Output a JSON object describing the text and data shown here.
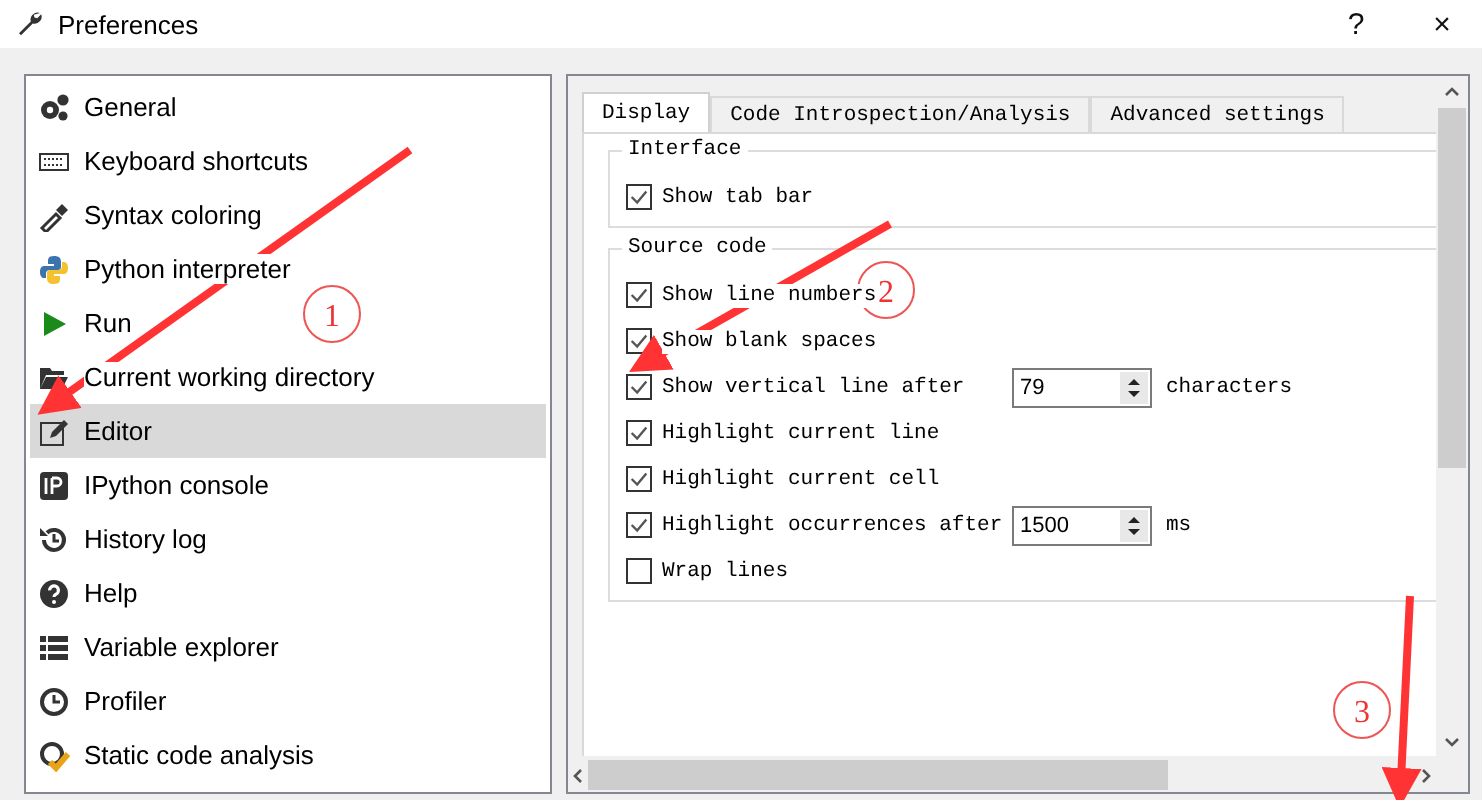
{
  "window": {
    "title": "Preferences",
    "help": "?",
    "close": "×"
  },
  "sidebar": {
    "items": [
      {
        "label": "General",
        "selected": false
      },
      {
        "label": "Keyboard shortcuts",
        "selected": false
      },
      {
        "label": "Syntax coloring",
        "selected": false
      },
      {
        "label": "Python interpreter",
        "selected": false
      },
      {
        "label": "Run",
        "selected": false
      },
      {
        "label": "Current working directory",
        "selected": false
      },
      {
        "label": "Editor",
        "selected": true
      },
      {
        "label": "IPython console",
        "selected": false
      },
      {
        "label": "History log",
        "selected": false
      },
      {
        "label": "Help",
        "selected": false
      },
      {
        "label": "Variable explorer",
        "selected": false
      },
      {
        "label": "Profiler",
        "selected": false
      },
      {
        "label": "Static code analysis",
        "selected": false
      }
    ]
  },
  "tabs": [
    {
      "label": "Display",
      "selected": true
    },
    {
      "label": "Code Introspection/Analysis",
      "selected": false
    },
    {
      "label": "Advanced settings",
      "selected": false
    }
  ],
  "groups": [
    {
      "title": "Interface",
      "options": [
        {
          "kind": "checkbox",
          "label": "Show tab bar",
          "checked": true
        }
      ]
    },
    {
      "title": "Source code",
      "options": [
        {
          "kind": "checkbox",
          "label": "Show line numbers",
          "checked": true
        },
        {
          "kind": "checkbox",
          "label": "Show blank spaces",
          "checked": true
        },
        {
          "kind": "spin",
          "label": "Show vertical line after",
          "checked": true,
          "value": "79",
          "unit": "characters"
        },
        {
          "kind": "checkbox",
          "label": "Highlight current line",
          "checked": true
        },
        {
          "kind": "checkbox",
          "label": "Highlight current cell",
          "checked": true
        },
        {
          "kind": "spin",
          "label": "Highlight occurrences after",
          "checked": true,
          "value": "1500",
          "unit": "ms"
        },
        {
          "kind": "checkbox",
          "label": "Wrap lines",
          "checked": false
        }
      ]
    }
  ],
  "annotations": [
    {
      "number": "1"
    },
    {
      "number": "2"
    },
    {
      "number": "3"
    }
  ]
}
